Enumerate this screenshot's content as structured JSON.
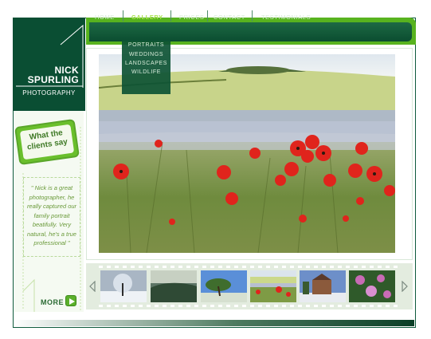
{
  "brand": {
    "name_line1": "NICK",
    "name_line2": "SPURLING",
    "tagline": "PHOTOGRAPHY"
  },
  "nav": {
    "items": [
      {
        "label": "HOME",
        "active": false
      },
      {
        "label": "GALLERY",
        "active": true
      },
      {
        "label": "PRICES",
        "active": false
      },
      {
        "label": "CONTACT",
        "active": false
      },
      {
        "label": "TESTIMONIALS",
        "active": false
      }
    ],
    "gallery_dropdown": [
      "PORTRAITS",
      "WEDDINGS",
      "LANDSCAPES",
      "WILDLIFE"
    ]
  },
  "sidebar": {
    "badge_line1": "What the",
    "badge_line2": "clients say",
    "quote": "\" Nick is a great photographer, he really captured our family portrait beatifully. Very natural, he's a true professional \"",
    "more_label": "MORE"
  },
  "filmstrip": {
    "thumbnails": [
      {
        "name": "thumb-snowy-tree"
      },
      {
        "name": "thumb-misty-valley"
      },
      {
        "name": "thumb-beach-tree"
      },
      {
        "name": "thumb-poppy-field"
      },
      {
        "name": "thumb-church"
      },
      {
        "name": "thumb-flowers"
      }
    ]
  },
  "colors": {
    "dark_green": "#0a4e33",
    "bright_green": "#58b31f",
    "active_nav": "#a7e14b",
    "quote_text": "#6a9a3a"
  }
}
